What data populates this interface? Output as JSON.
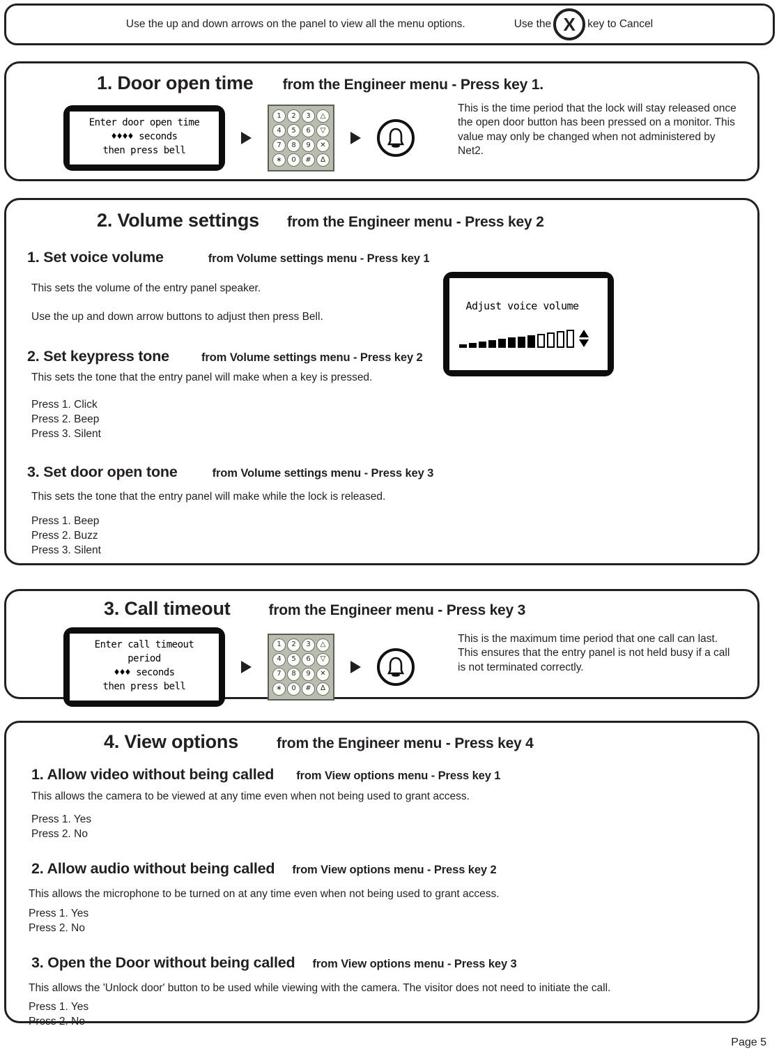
{
  "note_bar": {
    "left_text": "Use the up and down arrows on the panel to view all the menu options.",
    "right_prefix": "Use the",
    "key_glyph": "X",
    "right_suffix": "key to Cancel"
  },
  "sections": [
    {
      "id": "door-open-time",
      "title": "1. Door open time",
      "subtitle": "from the Engineer menu - Press key 1.",
      "lcd": "Enter door open time\n♦♦♦♦ seconds\nthen press bell",
      "description": "This is the time period that the lock will stay released once the open door button has been pressed on a monitor. This value may only be changed when not administered by Net2."
    },
    {
      "id": "volume-settings",
      "title": "2. Volume settings",
      "subtitle": "from the Engineer menu - Press key 2",
      "subsections": [
        {
          "id": "set-voice-volume",
          "title": "1. Set voice volume",
          "subtitle": "from Volume settings menu - Press key 1",
          "para1": "This sets the volume of the entry panel speaker.",
          "para2": "Use the up and down arrow buttons to adjust then press Bell.",
          "lcd_label": "Adjust voice volume",
          "vol_filled": 8,
          "vol_empty": 4
        },
        {
          "id": "set-keypress-tone",
          "title": "2. Set keypress tone",
          "subtitle": "from Volume settings menu - Press key 2",
          "para1": "This sets the tone that the entry panel will make when a key is pressed.",
          "options": "Press 1. Click\nPress 2. Beep\nPress 3. Silent"
        },
        {
          "id": "set-door-open-tone",
          "title": "3. Set door open tone",
          "subtitle": "from Volume settings menu - Press key 3",
          "para1": "This sets the tone that the entry panel will make while the lock is released.",
          "options": "Press 1. Beep\nPress 2. Buzz\nPress 3. Silent"
        }
      ]
    },
    {
      "id": "call-timeout",
      "title": "3. Call timeout",
      "subtitle": "from the Engineer menu - Press key 3",
      "lcd": "Enter call timeout period\n♦♦♦ seconds\nthen press bell",
      "description": "This is the maximum time period that one call can last. This ensures that the entry panel is not held busy if a call is not terminated correctly."
    },
    {
      "id": "view-options",
      "title": "4. View options",
      "subtitle": "from the Engineer menu - Press key 4",
      "subsections": [
        {
          "id": "allow-video-without-being-called",
          "title": "1. Allow video without being called",
          "subtitle": "from View options menu - Press key 1",
          "para1": "This allows the camera to be viewed at any time even when not being used to grant access.",
          "options": "Press 1. Yes\nPress 2. No"
        },
        {
          "id": "allow-audio-without-being-called",
          "title": "2. Allow audio without being called",
          "subtitle": "from View options menu - Press key 2",
          "para1": "This allows the microphone to be turned on at any time even when not being used to grant access.",
          "options": "Press 1. Yes\nPress 2. No"
        },
        {
          "id": "open-the-door-without-being-called",
          "title": "3. Open the Door without being called",
          "subtitle": "from View options menu - Press key 3",
          "para1": "This allows the 'Unlock door' button to be used while viewing with the camera. The visitor does not need to initiate the call.",
          "options": "Press 1. Yes\nPress 2. No"
        }
      ]
    }
  ],
  "keypad": {
    "keys": [
      "1",
      "2",
      "3",
      "△",
      "4",
      "5",
      "6",
      "▽",
      "7",
      "8",
      "9",
      "✕",
      "∗",
      "0",
      "#",
      "∆"
    ]
  },
  "bell_glyph": "⬤",
  "footer": {
    "page": "Page 5"
  }
}
